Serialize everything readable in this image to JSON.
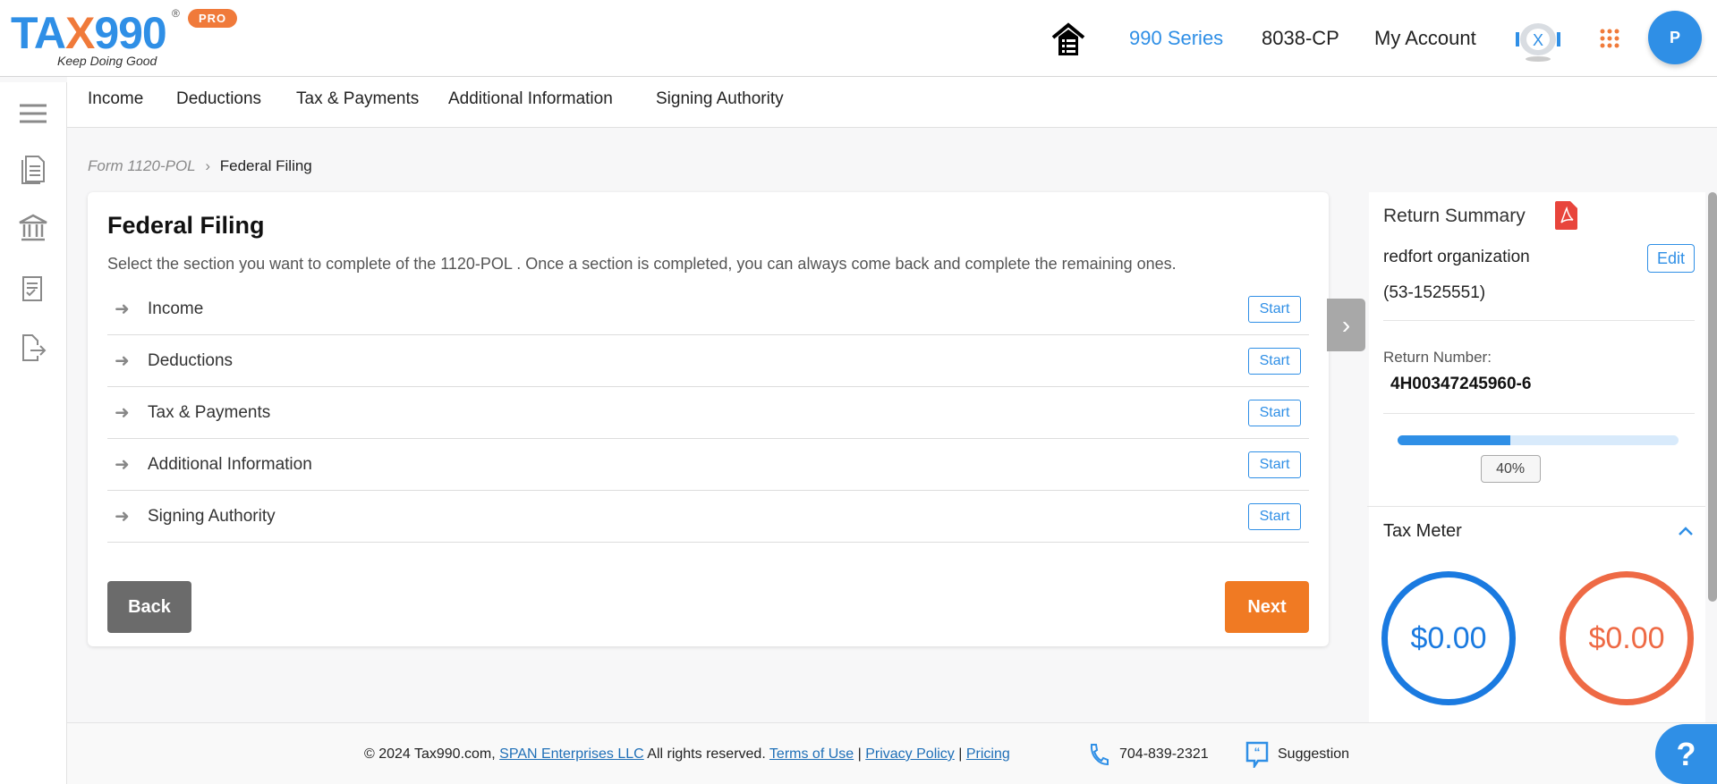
{
  "header": {
    "logo_text": "TAX990",
    "logo_tagline": "Keep Doing Good",
    "logo_badge": "PRO",
    "nav": [
      {
        "label": "990 Series",
        "active": true
      },
      {
        "label": "8038-CP"
      },
      {
        "label": "My Account"
      }
    ],
    "avatar_initial": "P",
    "accent": "#2f8fe6",
    "orange": "#f07a3a"
  },
  "subnav": [
    "Income",
    "Deductions",
    "Tax & Payments",
    "Additional Information",
    "Signing Authority"
  ],
  "breadcrumb": {
    "parent": "Form 1120-POL",
    "current": "Federal Filing"
  },
  "main": {
    "title": "Federal Filing",
    "description": "Select the section you want to complete of the 1120-POL . Once a section is completed, you can always come back and complete the remaining ones.",
    "sections": [
      {
        "label": "Income",
        "action": "Start"
      },
      {
        "label": "Deductions",
        "action": "Start"
      },
      {
        "label": "Tax & Payments",
        "action": "Start"
      },
      {
        "label": "Additional Information",
        "action": "Start"
      },
      {
        "label": "Signing Authority",
        "action": "Start"
      }
    ],
    "back_label": "Back",
    "next_label": "Next"
  },
  "summary": {
    "title": "Return Summary",
    "org": "redfort organization",
    "ein": "(53-1525551)",
    "edit_label": "Edit",
    "return_number_label": "Return Number:",
    "return_number": "4H00347245960-6",
    "progress_percent": 40,
    "progress_label": "40%",
    "tax_meter_title": "Tax Meter",
    "meter_left": "$0.00",
    "meter_right": "$0.00"
  },
  "footer": {
    "copyright": "© 2024 Tax990.com,",
    "company": "SPAN Enterprises LLC",
    "rights": "All rights reserved.",
    "terms": "Terms of Use",
    "privacy": "Privacy Policy",
    "pricing": "Pricing",
    "phone": "704-839-2321",
    "suggestion": "Suggestion"
  },
  "help_label": "?"
}
